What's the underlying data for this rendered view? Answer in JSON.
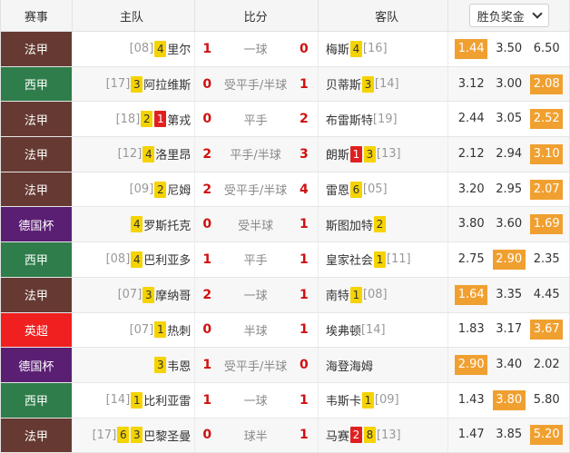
{
  "header": {
    "league": "赛事",
    "home": "主队",
    "score": "比分",
    "away": "客队",
    "odds_select": "胜负奖金"
  },
  "league_colors": {
    "法甲": "#663a32",
    "西甲": "#2e7d4a",
    "德国杯": "#5a1f73",
    "英超": "#f02020"
  },
  "rows": [
    {
      "league": "法甲",
      "home_rank": "[08]",
      "home_badges": [
        {
          "t": "4",
          "c": "y"
        }
      ],
      "home": "里尔",
      "hg": "1",
      "hcp": "一球",
      "ag": "0",
      "away": "梅斯",
      "away_badges": [
        {
          "t": "4",
          "c": "y"
        }
      ],
      "away_rank": "[16]",
      "odds": [
        "1.44",
        "3.50",
        "6.50"
      ],
      "hi": 0
    },
    {
      "league": "西甲",
      "home_rank": "[17]",
      "home_badges": [
        {
          "t": "3",
          "c": "y"
        }
      ],
      "home": "阿拉维斯",
      "hg": "0",
      "hcp": "受平手/半球",
      "ag": "1",
      "away": "贝蒂斯",
      "away_badges": [
        {
          "t": "3",
          "c": "y"
        }
      ],
      "away_rank": "[14]",
      "odds": [
        "3.12",
        "3.00",
        "2.08"
      ],
      "hi": 2
    },
    {
      "league": "法甲",
      "home_rank": "[18]",
      "home_badges": [
        {
          "t": "2",
          "c": "y"
        },
        {
          "t": "1",
          "c": "r"
        }
      ],
      "home": "第戎",
      "hg": "0",
      "hcp": "平手",
      "ag": "2",
      "away": "布雷斯特",
      "away_badges": [],
      "away_rank": "[19]",
      "odds": [
        "2.44",
        "3.05",
        "2.52"
      ],
      "hi": 2
    },
    {
      "league": "法甲",
      "home_rank": "[12]",
      "home_badges": [
        {
          "t": "4",
          "c": "y"
        }
      ],
      "home": "洛里昂",
      "hg": "2",
      "hcp": "平手/半球",
      "ag": "3",
      "away": "朗斯",
      "away_badges": [
        {
          "t": "1",
          "c": "r"
        },
        {
          "t": "3",
          "c": "y"
        }
      ],
      "away_rank": "[13]",
      "odds": [
        "2.12",
        "2.94",
        "3.10"
      ],
      "hi": 2
    },
    {
      "league": "法甲",
      "home_rank": "[09]",
      "home_badges": [
        {
          "t": "2",
          "c": "y"
        }
      ],
      "home": "尼姆",
      "hg": "2",
      "hcp": "受平手/半球",
      "ag": "4",
      "away": "雷恩",
      "away_badges": [
        {
          "t": "6",
          "c": "y"
        }
      ],
      "away_rank": "[05]",
      "odds": [
        "3.20",
        "2.95",
        "2.07"
      ],
      "hi": 2
    },
    {
      "league": "德国杯",
      "home_rank": "",
      "home_badges": [
        {
          "t": "4",
          "c": "y"
        }
      ],
      "home": "罗斯托克",
      "hg": "0",
      "hcp": "受半球",
      "ag": "1",
      "away": "斯图加特",
      "away_badges": [
        {
          "t": "2",
          "c": "y"
        }
      ],
      "away_rank": "",
      "odds": [
        "3.80",
        "3.60",
        "1.69"
      ],
      "hi": 2
    },
    {
      "league": "西甲",
      "home_rank": "[08]",
      "home_badges": [
        {
          "t": "4",
          "c": "y"
        }
      ],
      "home": "巴利亚多",
      "hg": "1",
      "hcp": "平手",
      "ag": "1",
      "away": "皇家社会",
      "away_badges": [
        {
          "t": "1",
          "c": "y"
        }
      ],
      "away_rank": "[11]",
      "odds": [
        "2.75",
        "2.90",
        "2.35"
      ],
      "hi": 1
    },
    {
      "league": "法甲",
      "home_rank": "[07]",
      "home_badges": [
        {
          "t": "3",
          "c": "y"
        }
      ],
      "home": "摩纳哥",
      "hg": "2",
      "hcp": "一球",
      "ag": "1",
      "away": "南特",
      "away_badges": [
        {
          "t": "1",
          "c": "y"
        }
      ],
      "away_rank": "[08]",
      "odds": [
        "1.64",
        "3.35",
        "4.45"
      ],
      "hi": 0
    },
    {
      "league": "英超",
      "home_rank": "[07]",
      "home_badges": [
        {
          "t": "1",
          "c": "y"
        }
      ],
      "home": "热刺",
      "hg": "0",
      "hcp": "半球",
      "ag": "1",
      "away": "埃弗顿",
      "away_badges": [],
      "away_rank": "[14]",
      "odds": [
        "1.83",
        "3.17",
        "3.67"
      ],
      "hi": 2
    },
    {
      "league": "德国杯",
      "home_rank": "",
      "home_badges": [
        {
          "t": "3",
          "c": "y"
        }
      ],
      "home": "韦恩",
      "hg": "1",
      "hcp": "受平手/半球",
      "ag": "0",
      "away": "海登海姆",
      "away_badges": [],
      "away_rank": "",
      "odds": [
        "2.90",
        "3.40",
        "2.02"
      ],
      "hi": 0
    },
    {
      "league": "西甲",
      "home_rank": "[14]",
      "home_badges": [
        {
          "t": "1",
          "c": "y"
        }
      ],
      "home": "比利亚雷",
      "hg": "1",
      "hcp": "一球",
      "ag": "1",
      "away": "韦斯卡",
      "away_badges": [
        {
          "t": "1",
          "c": "y"
        }
      ],
      "away_rank": "[09]",
      "odds": [
        "1.43",
        "3.80",
        "5.80"
      ],
      "hi": 1
    },
    {
      "league": "法甲",
      "home_rank": "[17]",
      "home_badges": [
        {
          "t": "6",
          "c": "y"
        },
        {
          "t": "3",
          "c": "y"
        }
      ],
      "home": "巴黎圣曼",
      "hg": "0",
      "hcp": "球半",
      "ag": "1",
      "away": "马赛",
      "away_badges": [
        {
          "t": "2",
          "c": "r"
        },
        {
          "t": "8",
          "c": "y"
        }
      ],
      "away_rank": "[13]",
      "odds": [
        "1.47",
        "3.85",
        "5.20"
      ],
      "hi": 2
    }
  ]
}
